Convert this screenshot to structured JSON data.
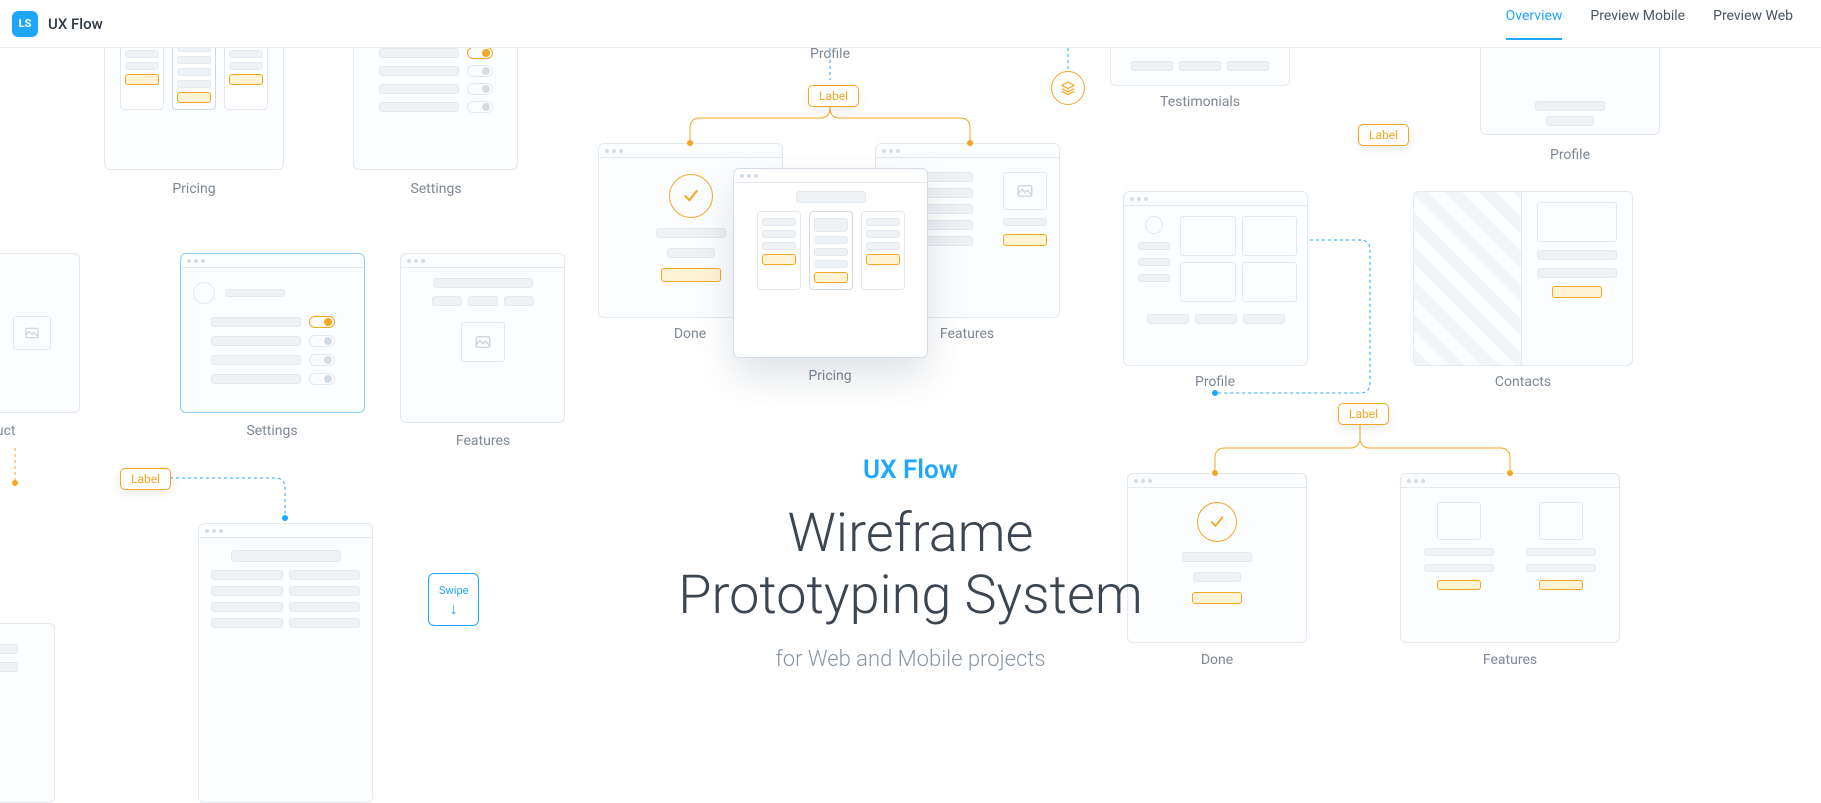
{
  "header": {
    "logo_text": "UX Flow",
    "logo_glyph": "LS",
    "nav": [
      {
        "label": "Overview",
        "active": true
      },
      {
        "label": "Preview Mobile",
        "active": false
      },
      {
        "label": "Preview Web",
        "active": false
      }
    ]
  },
  "hero": {
    "brand": "UX Flow",
    "title_line1": "Wireframe",
    "title_line2": "Prototyping System",
    "subtitle": "for Web and Mobile projects"
  },
  "labels": {
    "profile_top": "Profile",
    "testimonials": "Testimonials",
    "pricing_left": "Pricing",
    "settings_left": "Settings",
    "done_center": "Done",
    "pricing_center": "Pricing",
    "features_center": "Features",
    "profile_right": "Profile",
    "profile_far_right": "Profile",
    "contacts": "Contacts",
    "product": "oduct",
    "settings_lower": "Settings",
    "features_lower": "Features",
    "done_right": "Done",
    "features_right": "Features"
  },
  "tags": {
    "label_top": "Label",
    "label_left": "Label",
    "label_right_top": "Label",
    "label_right_mid": "Label",
    "swipe": "Swipe"
  },
  "colors": {
    "accent_blue": "#1fa7ff",
    "accent_orange": "#f5a623",
    "wireframe_stroke": "#e3e9ee",
    "text_muted": "#7d8893"
  }
}
